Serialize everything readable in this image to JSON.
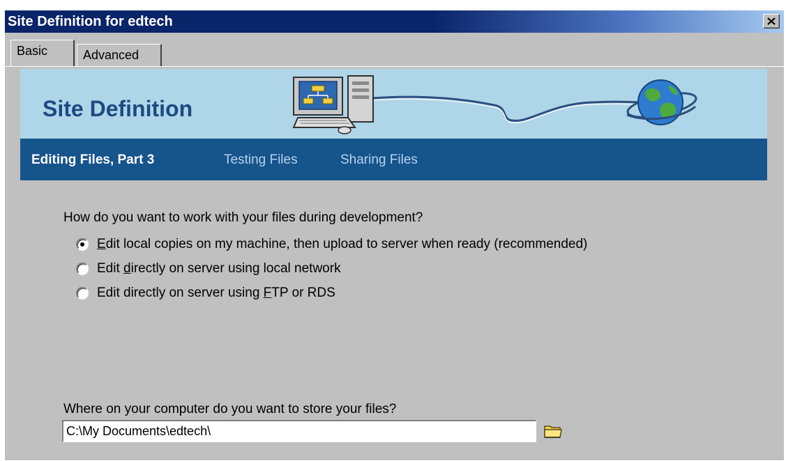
{
  "window": {
    "title": "Site Definition for edtech",
    "close_symbol": "✕"
  },
  "tabs": [
    {
      "label": "Basic",
      "active": true
    },
    {
      "label": "Advanced",
      "active": false
    }
  ],
  "banner": {
    "title": "Site Definition",
    "icons": [
      "computer-icon",
      "globe-icon"
    ]
  },
  "steps": {
    "current": "Editing Files, Part 3",
    "next": [
      "Testing Files",
      "Sharing Files"
    ]
  },
  "question": "How do you want to work with your files during development?",
  "options": [
    {
      "pre": "",
      "accel": "E",
      "post": "dit local copies on my machine, then upload to server when ready (recommended)",
      "checked": true
    },
    {
      "pre": "Edit ",
      "accel": "d",
      "post": "irectly on server using local network",
      "checked": false
    },
    {
      "pre": "Edit directly on server using ",
      "accel": "F",
      "post": "TP or RDS",
      "checked": false
    }
  ],
  "local_folder": {
    "label": "Where on your computer do you want to store your files?",
    "value": "C:\\My Documents\\edtech\\",
    "browse_icon": "folder-icon"
  },
  "colors": {
    "title_bar": "#0a246a",
    "banner_bg": "#afd5e8",
    "step_bar": "#16548c",
    "dialog_bg": "#c0c0c0"
  }
}
